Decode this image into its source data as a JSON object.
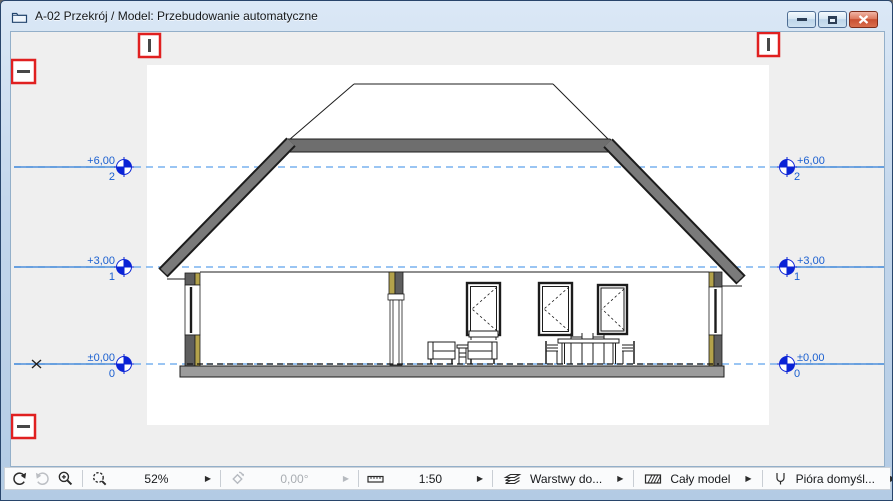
{
  "titlebar": {
    "title": "A-02 Przekrój / Model: Przebudowanie automatyczne"
  },
  "levels": [
    {
      "value": "+6,00",
      "story": "2"
    },
    {
      "value": "+3,00",
      "story": "1"
    },
    {
      "value": "±0,00",
      "story": "0"
    }
  ],
  "toolbar": {
    "zoom_value": "52%",
    "rotation_value": "0,00°",
    "scale_value": "1:50",
    "layers_label": "Warstwy do...",
    "model_filter_label": "Cały model",
    "pens_label": "Pióra domyśl...",
    "expand_arrow": "▶"
  },
  "colors": {
    "level_text_blue": "#1a5fd0",
    "level_line_blue": "#5ea2ec",
    "marker_fill_blue": "#0a23d6",
    "handle_red": "#e02020",
    "roof_gray": "#7a7a7a",
    "wall_gray": "#5e5e5e",
    "wall_yellow": "#b3a24b",
    "slab_gray": "#9c9c9c",
    "canvas_gray": "#efefef"
  }
}
